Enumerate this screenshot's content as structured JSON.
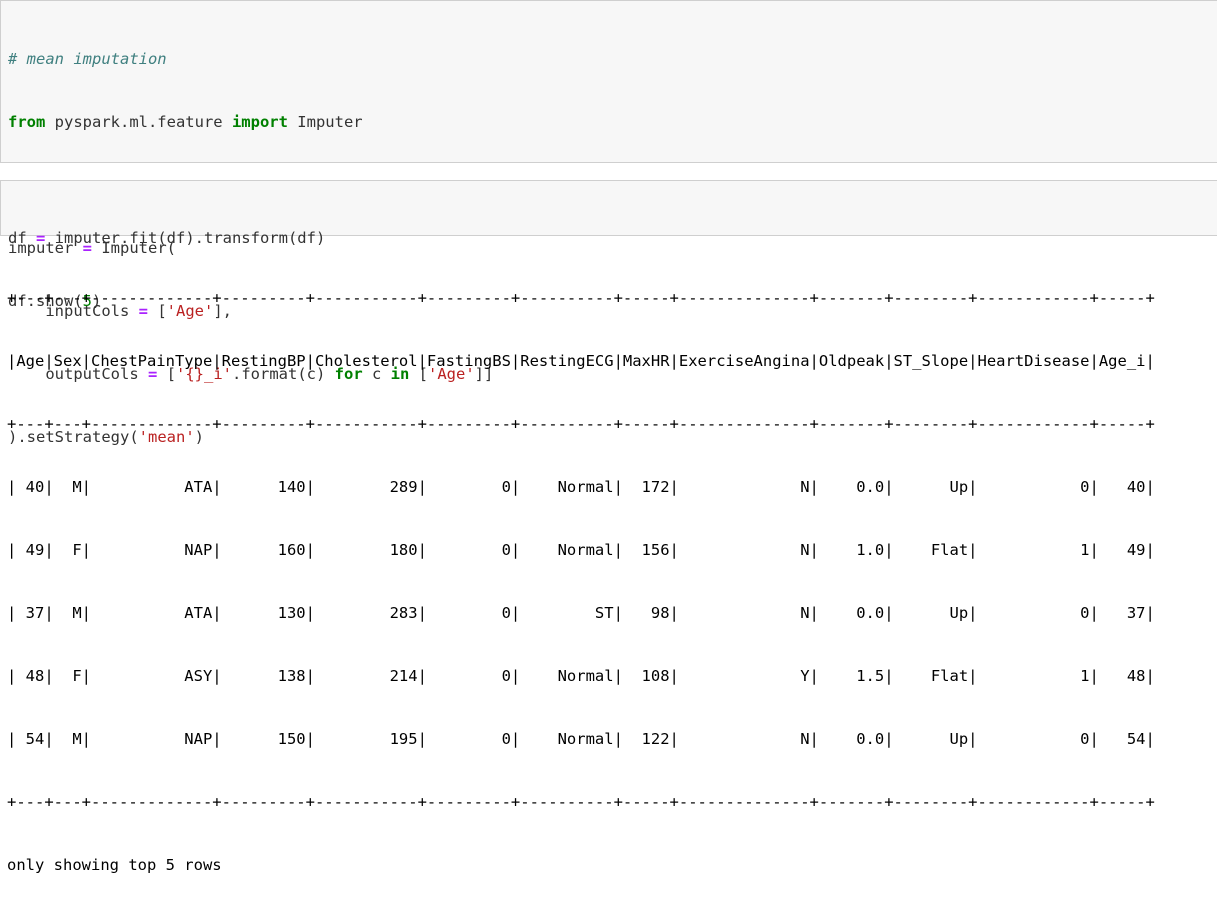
{
  "cell1": {
    "comment": "# mean imputation",
    "import_from": "from",
    "import_module": " pyspark.ml.feature ",
    "import_kw": "import",
    "import_name": " Imputer",
    "l3_var": "imputer ",
    "l3_eq": "=",
    "l3_rest": " Imputer(",
    "l4_pre": "    inputCols ",
    "l4_eq": "=",
    "l4_mid": " [",
    "l4_str": "'Age'",
    "l4_post": "],",
    "l5_pre": "    outputCols ",
    "l5_eq": "=",
    "l5_mid": " [",
    "l5_str": "'{}_i'",
    "l5_mid2": ".format(c) ",
    "l5_for": "for",
    "l5_c": " c ",
    "l5_in": "in",
    "l5_mid3": " [",
    "l5_str2": "'Age'",
    "l5_post": "]]",
    "l6_pre": ").setStrategy(",
    "l6_str": "'mean'",
    "l6_post": ")"
  },
  "cell2": {
    "l1_pre": "df ",
    "l1_eq": "=",
    "l1_post": " imputer.fit(df).transform(df)",
    "l2_pre": "df.show(",
    "l2_num": "5",
    "l2_post": ")"
  },
  "output": {
    "separator": "+---+---+-------------+---------+-----------+---------+----------+-----+--------------+-------+--------+------------+-----+",
    "header": "|Age|Sex|ChestPainType|RestingBP|Cholesterol|FastingBS|RestingECG|MaxHR|ExerciseAngina|Oldpeak|ST_Slope|HeartDisease|Age_i|",
    "rows": [
      "| 40|  M|          ATA|      140|        289|        0|    Normal|  172|             N|    0.0|      Up|           0|   40|",
      "| 49|  F|          NAP|      160|        180|        0|    Normal|  156|             N|    1.0|    Flat|           1|   49|",
      "| 37|  M|          ATA|      130|        283|        0|        ST|   98|             N|    0.0|      Up|           0|   37|",
      "| 48|  F|          ASY|      138|        214|        0|    Normal|  108|             Y|    1.5|    Flat|           1|   48|",
      "| 54|  M|          NAP|      150|        195|        0|    Normal|  122|             N|    0.0|      Up|           0|   54|"
    ],
    "footer": "only showing top 5 rows"
  }
}
